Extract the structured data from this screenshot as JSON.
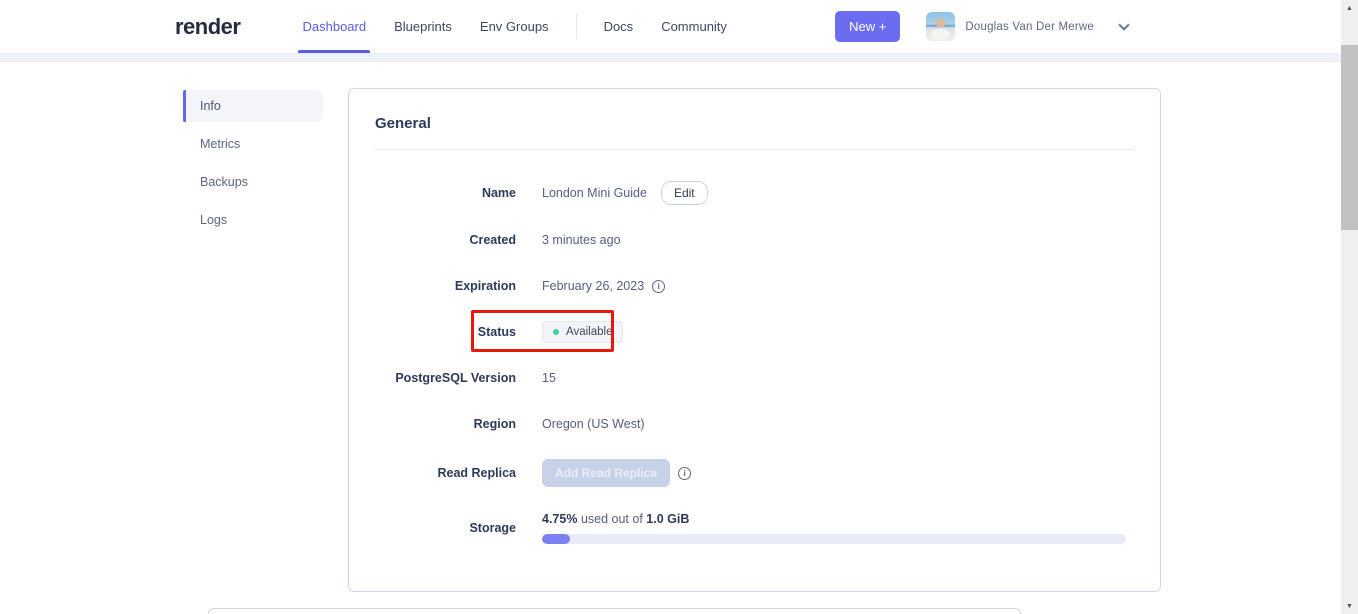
{
  "nav": {
    "logo": "render",
    "items": [
      {
        "label": "Dashboard",
        "active": true
      },
      {
        "label": "Blueprints",
        "active": false
      },
      {
        "label": "Env Groups",
        "active": false
      },
      {
        "label": "Docs",
        "active": false
      },
      {
        "label": "Community",
        "active": false
      }
    ],
    "new_button_label": "New +",
    "user_name": "Douglas Van Der Merwe"
  },
  "sidebar": {
    "items": [
      {
        "label": "Info",
        "active": true
      },
      {
        "label": "Metrics",
        "active": false
      },
      {
        "label": "Backups",
        "active": false
      },
      {
        "label": "Logs",
        "active": false
      }
    ]
  },
  "general": {
    "title": "General",
    "name": {
      "label": "Name",
      "value": "London Mini Guide",
      "edit_button": "Edit"
    },
    "created": {
      "label": "Created",
      "value": "3 minutes ago"
    },
    "expiration": {
      "label": "Expiration",
      "value": "February 26, 2023"
    },
    "status": {
      "label": "Status",
      "badge": "Available"
    },
    "postgresql_version": {
      "label": "PostgreSQL Version",
      "value": "15"
    },
    "region": {
      "label": "Region",
      "value": "Oregon (US West)"
    },
    "read_replica": {
      "label": "Read Replica",
      "button": "Add Read Replica"
    },
    "storage": {
      "label": "Storage",
      "used_pct": "4.75%",
      "infix": "used out of",
      "total": "1.0 GiB",
      "progress_percent": 4.75
    }
  },
  "icons": {
    "info": "i",
    "scroll_up": "▲",
    "scroll_down": "▼"
  },
  "colors": {
    "accent": "#585ee2",
    "new_button": "#6b6cf0",
    "progress_fill": "#7b80f2",
    "status_dot": "#3ecf9e",
    "annotation_red": "#e8190b"
  }
}
